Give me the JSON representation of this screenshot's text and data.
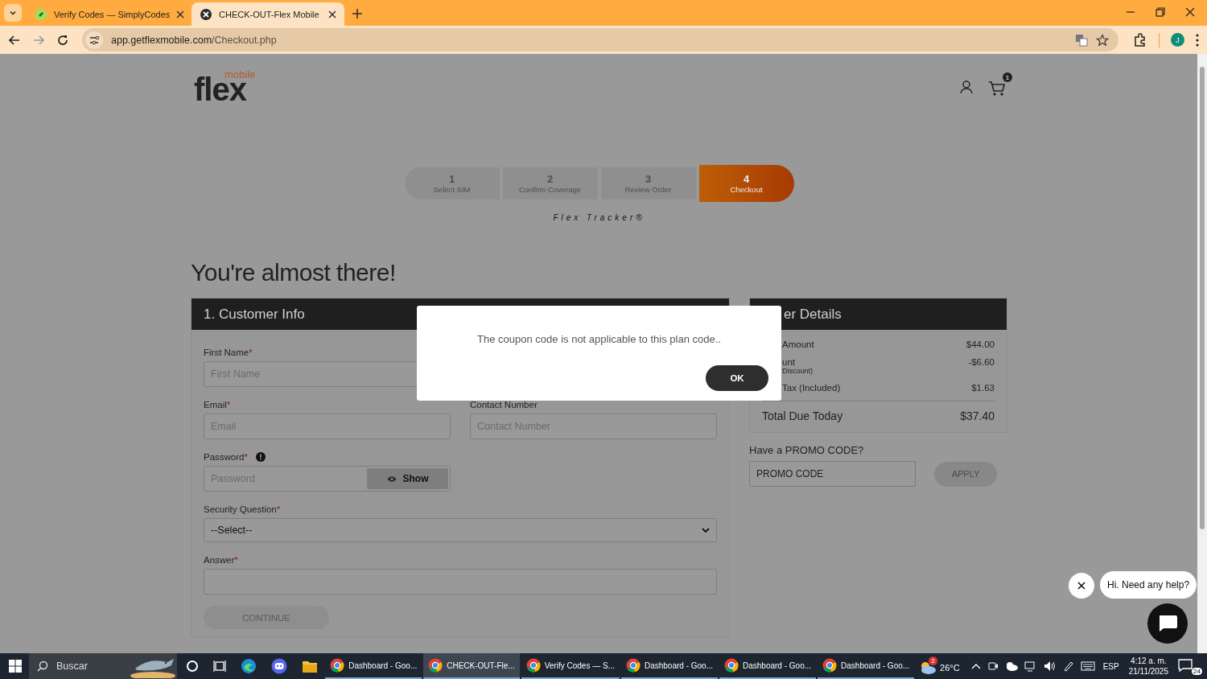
{
  "browser": {
    "tabs": [
      {
        "title": "Verify Codes — SimplyCodes",
        "selected": false
      },
      {
        "title": "CHECK-OUT-Flex Mobile",
        "selected": true
      }
    ],
    "url": {
      "host": "app.getflexmobile.com",
      "path": "/Checkout.php"
    },
    "profile_initial": "J"
  },
  "header": {
    "logo_main": "flex",
    "logo_sub": "mobile",
    "cart_count": "1"
  },
  "stepper": {
    "steps": [
      {
        "number": "1",
        "label": "Select SIM",
        "selected": false
      },
      {
        "number": "2",
        "label": "Confirm Coverage",
        "selected": false
      },
      {
        "number": "3",
        "label": "Review Order",
        "selected": false
      },
      {
        "number": "4",
        "label": "Checkout",
        "selected": true
      }
    ],
    "tracker": "Flex Tracker®"
  },
  "heading": "You're almost there!",
  "customer_info": {
    "title": "1. Customer Info",
    "rows": [
      [
        {
          "kind": "text",
          "label": "First Name",
          "mark": "*",
          "placeholder": "First Name"
        }
      ],
      [
        {
          "kind": "text",
          "label": "Email",
          "mark": "*",
          "placeholder": "Email"
        },
        {
          "kind": "text",
          "label": "Contact Number",
          "placeholder": "Contact Number"
        }
      ],
      [
        {
          "kind": "password",
          "label": "Password",
          "mark": "*",
          "placeholder": "Password",
          "button": "Show"
        }
      ],
      [
        {
          "kind": "select",
          "label": "Security Question",
          "mark": "*",
          "value": "--Select--"
        }
      ],
      [
        {
          "kind": "wide-text",
          "label": "Answer",
          "mark": "*"
        }
      ]
    ],
    "continue": {
      "label": "CONTINUE",
      "disabled": true
    }
  },
  "order_details": {
    "title": "er Details",
    "rows": [
      {
        "label": "Amount",
        "value": "$44.00"
      },
      {
        "label": "unt",
        "note": "Discount)",
        "value": "-$6.60"
      },
      {
        "label": "Tax (Included)",
        "value": "$1.63"
      }
    ],
    "total": {
      "label": "Total Due Today",
      "value": "$37.40"
    },
    "promo": {
      "label": "Have a PROMO CODE?",
      "placeholder": "PROMO CODE",
      "apply": "APPLY",
      "apply_disabled": true
    }
  },
  "dialog": {
    "message": "The coupon code is not applicable to this plan code..",
    "button": "OK"
  },
  "chat": {
    "greeting": "Hi. Need any help?"
  },
  "taskbar": {
    "search": "Buscar",
    "apps": [
      {
        "title": "Dashboard - Goo...",
        "selected": false
      },
      {
        "title": "CHECK-OUT-Fle...",
        "selected": true
      },
      {
        "title": "Verify Codes — S...",
        "selected": false
      },
      {
        "title": "Dashboard - Goo...",
        "selected": false
      },
      {
        "title": "Dashboard - Goo...",
        "selected": false
      },
      {
        "title": "Dashboard - Goo...",
        "selected": false
      }
    ],
    "weather_badge": "2",
    "temperature": "26°C",
    "language": "ESP",
    "time": "4:12 a. m.",
    "date": "21/11/2025",
    "notifications": "24"
  }
}
